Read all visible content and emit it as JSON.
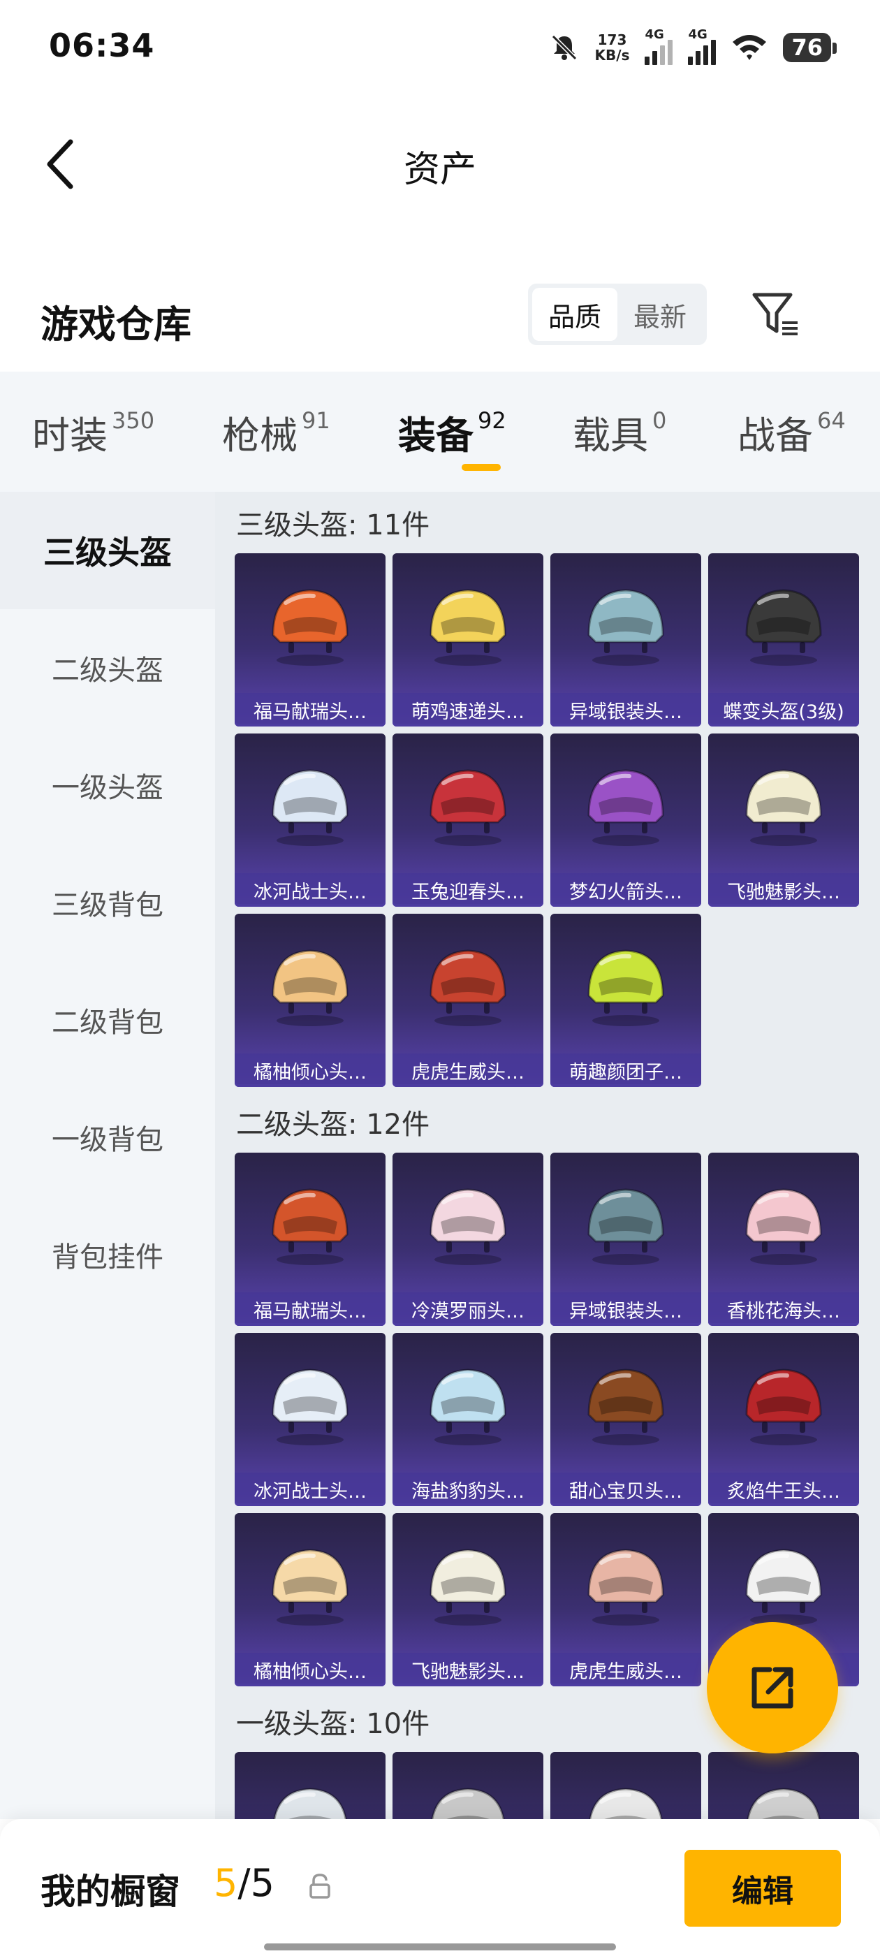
{
  "status_bar": {
    "time": "06:34",
    "net_speed_value": "173",
    "net_speed_unit": "KB/s",
    "sim1_label": "4G",
    "sim2_label": "4G",
    "battery": "76"
  },
  "header": {
    "title": "资产"
  },
  "section": {
    "title": "游戏仓库",
    "sort_options": [
      "品质",
      "最新"
    ],
    "active_sort": "品质"
  },
  "tabs": [
    {
      "label": "时装",
      "count": "350"
    },
    {
      "label": "枪械",
      "count": "91"
    },
    {
      "label": "装备",
      "count": "92"
    },
    {
      "label": "载具",
      "count": "0"
    },
    {
      "label": "战备",
      "count": "64"
    }
  ],
  "active_tab": "装备",
  "sidebar": {
    "items": [
      "三级头盔",
      "二级头盔",
      "一级头盔",
      "三级背包",
      "二级背包",
      "一级背包",
      "背包挂件"
    ],
    "active": "三级头盔"
  },
  "groups": [
    {
      "title": "三级头盔: 11件",
      "items": [
        {
          "name": "福马献瑞头…",
          "color": "#e8652c"
        },
        {
          "name": "萌鸡速递头…",
          "color": "#f3d35a"
        },
        {
          "name": "异域银装头…",
          "color": "#8fb8c4"
        },
        {
          "name": "蝶变头盔(3级)",
          "color": "#3a3a3a"
        },
        {
          "name": "冰河战士头…",
          "color": "#dde8f5"
        },
        {
          "name": "玉兔迎春头…",
          "color": "#c8333b"
        },
        {
          "name": "梦幻火箭头…",
          "color": "#9a52c6"
        },
        {
          "name": "飞驰魅影头…",
          "color": "#f1ecd0"
        },
        {
          "name": "橘柚倾心头…",
          "color": "#f2c483"
        },
        {
          "name": "虎虎生威头…",
          "color": "#c8432f"
        },
        {
          "name": "萌趣颜团子…",
          "color": "#c9e43a"
        }
      ]
    },
    {
      "title": "二级头盔: 12件",
      "items": [
        {
          "name": "福马献瑞头…",
          "color": "#d4552b"
        },
        {
          "name": "冷漠罗丽头…",
          "color": "#f3d7e0"
        },
        {
          "name": "异域银装头…",
          "color": "#6e8f9a"
        },
        {
          "name": "香桃花海头…",
          "color": "#f4c7cf"
        },
        {
          "name": "冰河战士头…",
          "color": "#e6eef7"
        },
        {
          "name": "海盐豹豹头…",
          "color": "#bfe0f0"
        },
        {
          "name": "甜心宝贝头…",
          "color": "#8a4a22"
        },
        {
          "name": "炙焰牛王头…",
          "color": "#b8262a"
        },
        {
          "name": "橘柚倾心头…",
          "color": "#f6d9a8"
        },
        {
          "name": "飞驰魅影头…",
          "color": "#f1eedf"
        },
        {
          "name": "虎虎生威头…",
          "color": "#e7b5a5"
        },
        {
          "name": "",
          "color": "#f2f2f2"
        }
      ]
    },
    {
      "title": "一级头盔: 10件",
      "items": [
        {
          "name": "",
          "color": "#dfe5ea"
        },
        {
          "name": "",
          "color": "#c8c8c8"
        },
        {
          "name": "",
          "color": "#e8e8e8"
        },
        {
          "name": "",
          "color": "#cfcfcf"
        }
      ]
    }
  ],
  "bottom_bar": {
    "label": "我的橱窗",
    "current": "5",
    "separator": "/",
    "total": "5",
    "edit_label": "编辑"
  },
  "colors": {
    "accent": "#ffb400",
    "card_bg": "#3b2f70"
  }
}
